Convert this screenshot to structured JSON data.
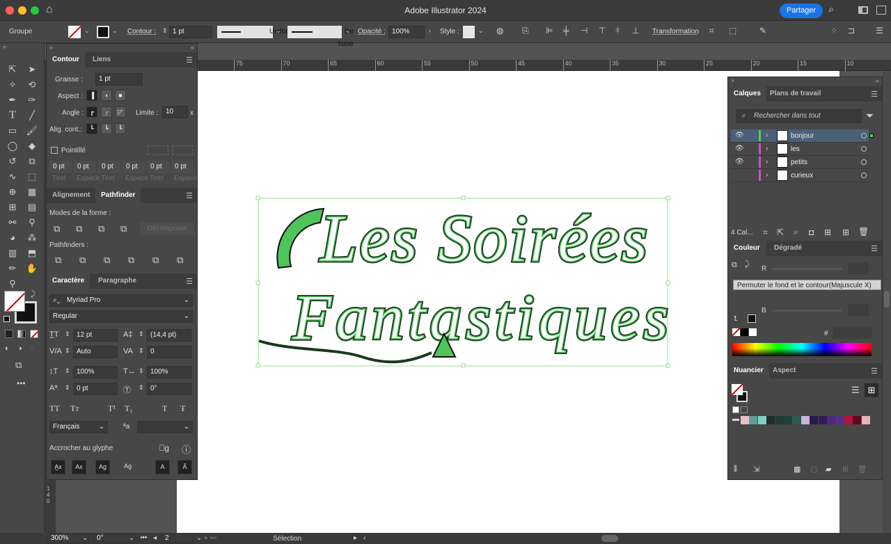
{
  "app": {
    "title": "Adobe Illustrator 2024",
    "share_label": "Partager"
  },
  "control_bar": {
    "selection_type": "Groupe",
    "stroke_label": "Contour :",
    "stroke_weight": "1 pt",
    "profile": "Uniforme",
    "brush": "De base",
    "opacity_label": "Opacité :",
    "opacity": "100%",
    "style_label": "Style :",
    "transform_label": "Transformation"
  },
  "ruler": {
    "ticks": [
      "75",
      "70",
      "65",
      "60",
      "55",
      "50",
      "45",
      "40",
      "35",
      "30",
      "25",
      "20",
      "15",
      "10"
    ],
    "vertical": "1 4 0"
  },
  "contour_panel": {
    "tabs": [
      "Contour",
      "Liens"
    ],
    "weight_label": "Graisse :",
    "weight": "1 pt",
    "cap_label": "Aspect :",
    "corner_label": "Angle :",
    "limit_label": "Limite :",
    "limit": "10",
    "limit_unit": "x",
    "align_label": "Alig. cont.:",
    "dashed_label": "Pointillé",
    "dash_values": [
      "0 pt",
      "0 pt",
      "0 pt",
      "0 pt",
      "0 pt",
      "0 pt"
    ],
    "dash_labels": [
      "Tiret",
      "Espace",
      "Tiret",
      "Espace",
      "Tiret",
      "Espace"
    ]
  },
  "pathfinder_panel": {
    "tabs": [
      "Alignement",
      "Pathfinder"
    ],
    "shape_modes_label": "Modes de la forme :",
    "expand_label": "Décomposer",
    "pathfinders_label": "Pathfinders :"
  },
  "character_panel": {
    "tabs": [
      "Caractère",
      "Paragraphe"
    ],
    "font_family": "Myriad Pro",
    "font_style": "Regular",
    "font_size": "12 pt",
    "leading": "(14,4 pt)",
    "kerning": "Auto",
    "tracking": "0",
    "vertical_scale": "100%",
    "horizontal_scale": "100%",
    "baseline_shift": "0 pt",
    "rotation": "0°",
    "language": "Français",
    "snap_label": "Accrocher au glyphe",
    "type_buttons": [
      "TT",
      "Tт",
      "T¹",
      "T₁",
      "T",
      "Ŧ"
    ]
  },
  "layers_panel": {
    "tabs": [
      "Calques",
      "Plans de travail"
    ],
    "search_placeholder": "Rechercher dans tout",
    "layers": [
      {
        "name": "bonjour",
        "visible": true,
        "color": "#4fd14f",
        "selected": true
      },
      {
        "name": "les",
        "visible": true,
        "color": "#c94fd1",
        "selected": false
      },
      {
        "name": "petits",
        "visible": true,
        "color": "#c94fd1",
        "selected": false
      },
      {
        "name": "curieux",
        "visible": false,
        "color": "#c94fd1",
        "selected": false
      }
    ],
    "count": "4 Cal..."
  },
  "color_panel": {
    "tabs": [
      "Couleur",
      "Dégradé"
    ],
    "channels": [
      "R",
      "B"
    ],
    "hex_label": "#",
    "tooltip": "Permuter le fond et le contour(Majuscule X)"
  },
  "swatches_panel": {
    "tabs": [
      "Nuancier",
      "Aspect"
    ],
    "swatches": [
      "#e9c2c8",
      "#5e9e94",
      "#7fcfc3",
      "#1d2e2a",
      "#213a34",
      "#22403a",
      "#2f5a50",
      "#c9b6e0",
      "#2a1b4a",
      "#311c55",
      "#4d2a7e",
      "#5a2f8c",
      "#b3133d",
      "#5d0b1e",
      "#e6b5b5"
    ]
  },
  "artwork": {
    "line1": "Les Soirées",
    "line2": "Fantastiques",
    "stroke": "#2e7d3a",
    "fill": "#4ec45a",
    "bbox_color": "#8fe08f"
  },
  "status": {
    "zoom": "300%",
    "rotation": "0°",
    "artboard": "2",
    "tool": "Sélection"
  }
}
